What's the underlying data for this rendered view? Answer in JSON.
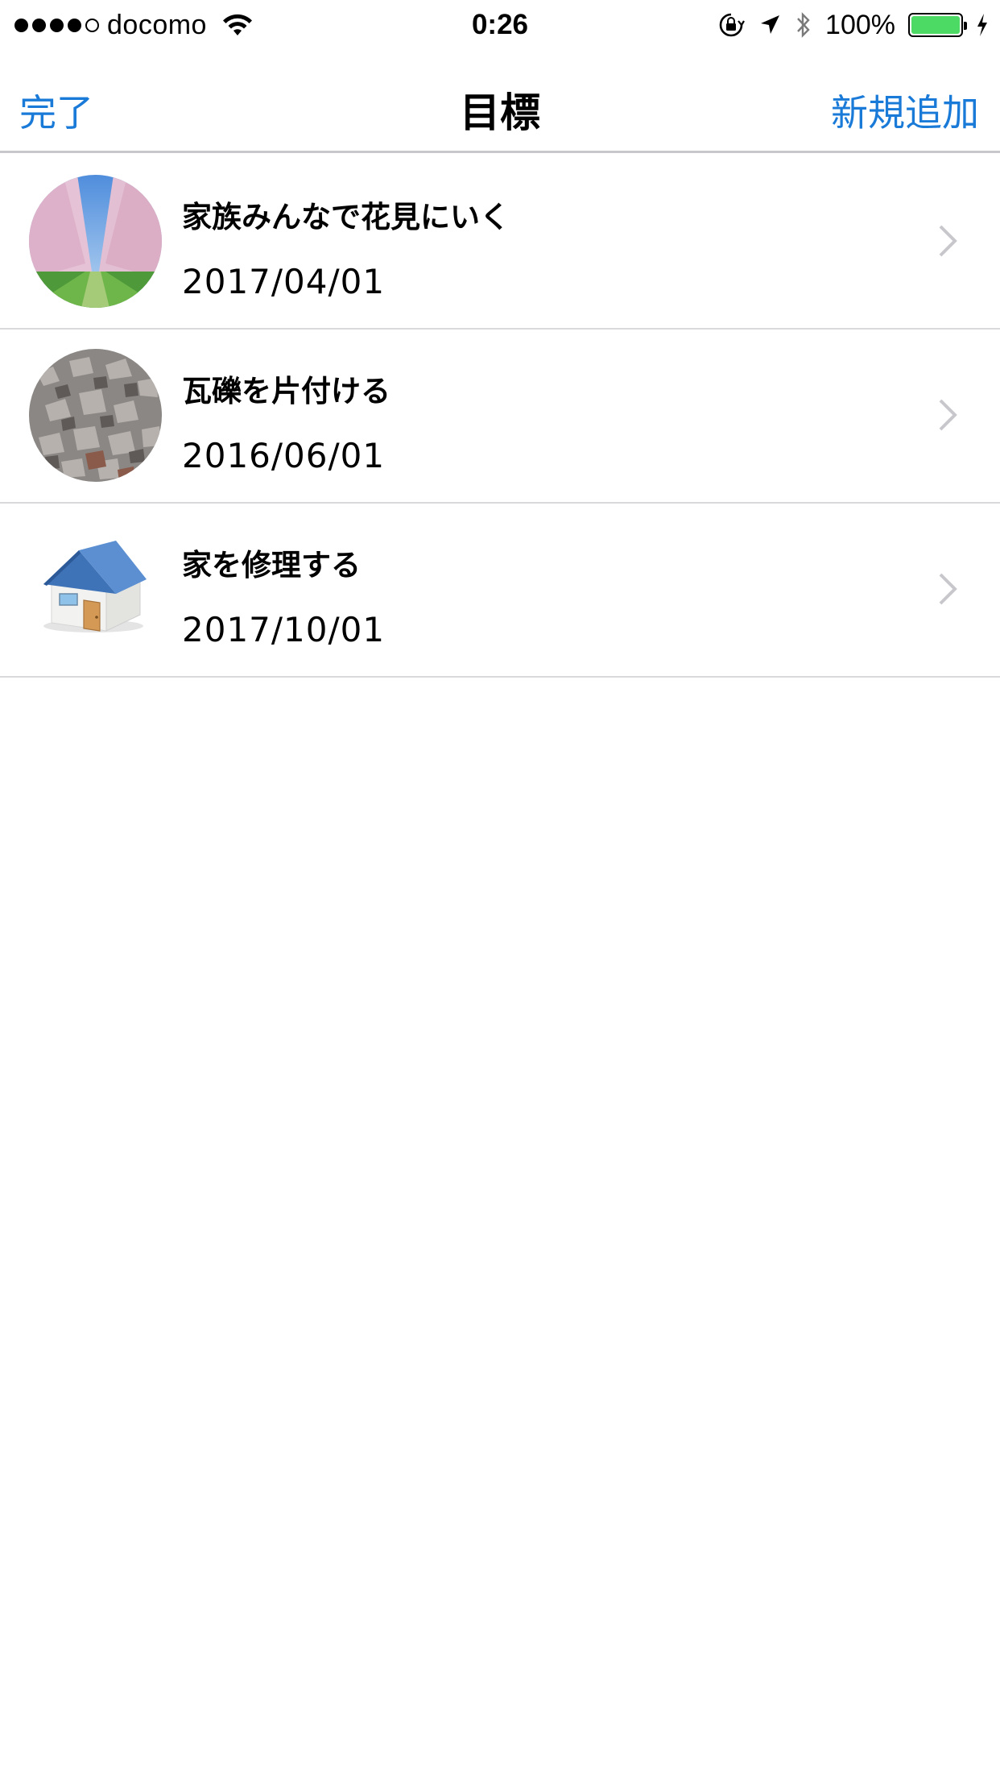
{
  "status_bar": {
    "carrier": "docomo",
    "time": "0:26",
    "battery_percent": "100%",
    "signal_bars": 4,
    "signal_max": 5,
    "battery_level": 1.0,
    "battery_color": "#4cd964"
  },
  "nav": {
    "left_label": "完了",
    "title": "目標",
    "right_label": "新規追加",
    "accent_color": "#1a7ad8"
  },
  "goals": [
    {
      "title": "家族みんなで花見にいく",
      "date": "2017/04/01",
      "image": "cherry-blossom-photo"
    },
    {
      "title": "瓦礫を片付ける",
      "date": "2016/06/01",
      "image": "rubble-photo"
    },
    {
      "title": "家を修理する",
      "date": "2017/10/01",
      "image": "house-illustration"
    }
  ]
}
